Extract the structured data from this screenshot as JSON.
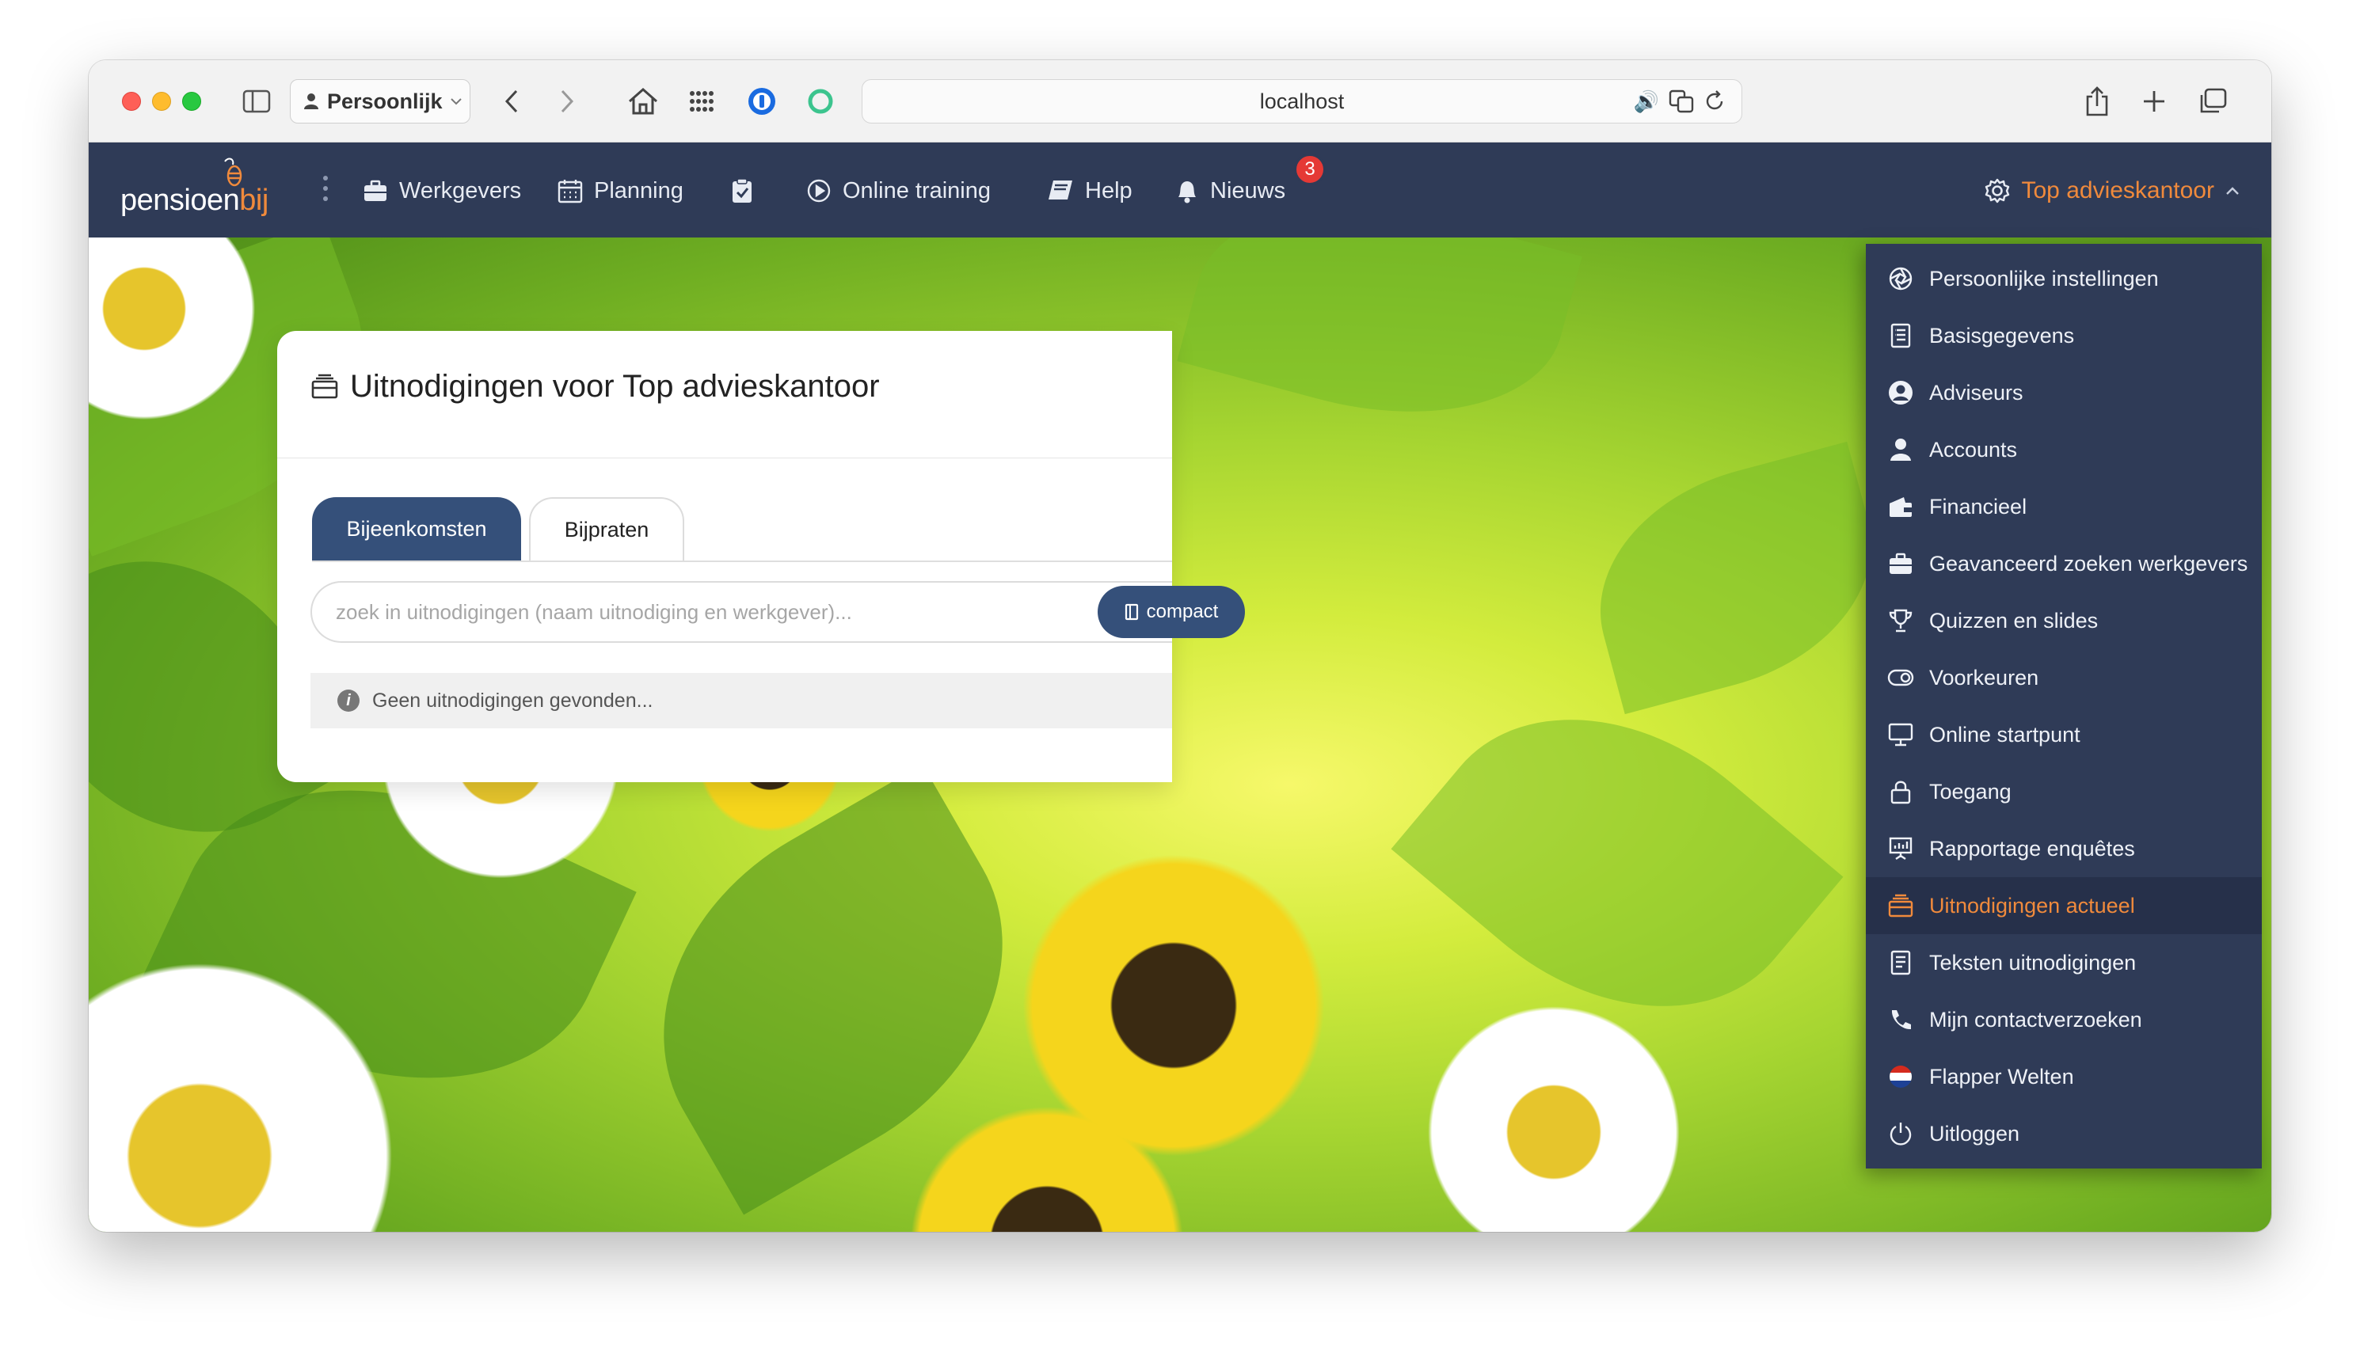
{
  "browser": {
    "profile_label": "Persoonlijk",
    "address": "localhost"
  },
  "nav": {
    "logo_main": "pensioen",
    "logo_accent": "bij",
    "items": [
      {
        "label": "Werkgevers",
        "icon": "briefcase-icon"
      },
      {
        "label": "Planning",
        "icon": "calendar-icon"
      },
      {
        "label": "",
        "icon": "clipboard-check-icon"
      },
      {
        "label": "Online training",
        "icon": "play-circle-icon"
      },
      {
        "label": "Help",
        "icon": "book-icon"
      },
      {
        "label": "Nieuws",
        "icon": "bell-icon"
      }
    ],
    "news_badge": "3",
    "account_label": "Top advieskantoor"
  },
  "page": {
    "title": "Uitnodigingen voor Top advieskantoor",
    "tabs": [
      {
        "label": "Bijeenkomsten",
        "active": true
      },
      {
        "label": "Bijpraten",
        "active": false
      }
    ],
    "search_placeholder": "zoek in uitnodigingen (naam uitnodiging en werkgever)...",
    "compact_label": "compact",
    "empty_message": "Geen uitnodigingen gevonden..."
  },
  "dropdown": {
    "items": [
      {
        "label": "Persoonlijke instellingen",
        "icon": "aperture-icon"
      },
      {
        "label": "Basisgegevens",
        "icon": "document-list-icon"
      },
      {
        "label": "Adviseurs",
        "icon": "user-circle-icon"
      },
      {
        "label": "Accounts",
        "icon": "user-icon"
      },
      {
        "label": "Financieel",
        "icon": "wallet-icon"
      },
      {
        "label": "Geavanceerd zoeken werkgevers",
        "icon": "briefcase-icon"
      },
      {
        "label": "Quizzen en slides",
        "icon": "trophy-icon"
      },
      {
        "label": "Voorkeuren",
        "icon": "toggle-icon"
      },
      {
        "label": "Online startpunt",
        "icon": "monitor-icon"
      },
      {
        "label": "Toegang",
        "icon": "lock-icon"
      },
      {
        "label": "Rapportage enquêtes",
        "icon": "presentation-chart-icon"
      },
      {
        "label": "Uitnodigingen actueel",
        "icon": "inbox-tray-icon",
        "active": true
      },
      {
        "label": "Teksten uitnodigingen",
        "icon": "text-document-icon"
      },
      {
        "label": "Mijn contactverzoeken",
        "icon": "phone-icon"
      },
      {
        "label": "Flapper Welten",
        "icon": "dutch-flag-icon"
      },
      {
        "label": "Uitloggen",
        "icon": "power-icon"
      }
    ]
  },
  "colors": {
    "nav_bg": "#2f3b57",
    "accent": "#f08a3c",
    "primary_button": "#35507a",
    "badge": "#e53935"
  }
}
